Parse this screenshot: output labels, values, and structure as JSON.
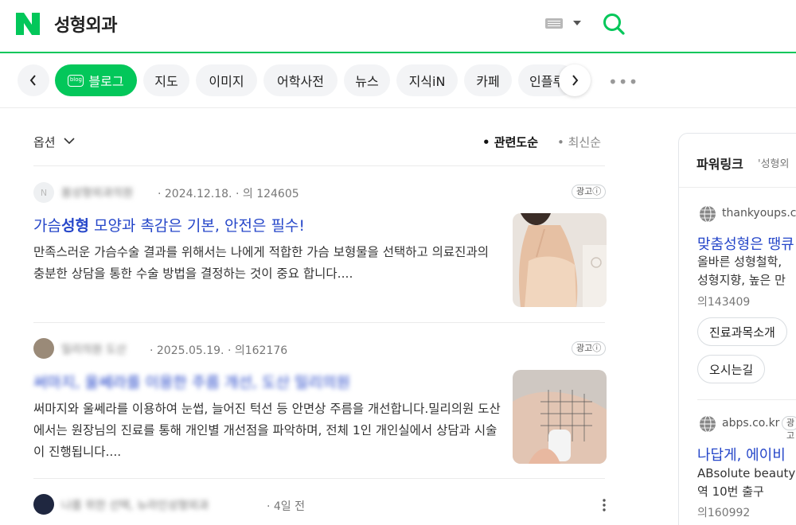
{
  "header": {
    "query": "성형외과",
    "colors": {
      "brand": "#03c75a",
      "link": "#2546c9"
    }
  },
  "tabs": {
    "items": [
      {
        "label": "블로그",
        "badge": "blog",
        "active": true
      },
      {
        "label": "지도"
      },
      {
        "label": "이미지"
      },
      {
        "label": "어학사전"
      },
      {
        "label": "뉴스"
      },
      {
        "label": "지식iN"
      },
      {
        "label": "카페"
      },
      {
        "label": "인플루"
      }
    ],
    "more": "•••"
  },
  "options": {
    "label": "옵션",
    "sort_relevance": "• 관련도순",
    "sort_recent": "• 최신순"
  },
  "results": [
    {
      "source": "봄성형외과의원",
      "meta": "· 2024.12.18. · 의 124605",
      "ad": "광고ⓘ",
      "title_pre": "가슴",
      "title_bold": "성형",
      "title_post": " 모양과 촉감은 기본, 안전은 필수!",
      "desc": "만족스러운 가슴수술 결과를 위해서는 나에게 적합한 가슴 보형물을 선택하고 의료진과의 충분한 상담을 통한 수술 방법을 결정하는 것이 중요 합니다...."
    },
    {
      "source": "밀리의원 도산",
      "meta": "· 2025.05.19. · 의162176",
      "ad": "광고ⓘ",
      "title": "써마지, 울쎄라를 이용한 주름 개선, 도산 밀리의원",
      "desc": "써마지와 울쎄라를 이용하여 눈썹, 늘어진 턱선 등 안면상 주름을 개선합니다.밀리의원 도산에서는 원장님의 진료를 통해 개인별 개선점을 파악하며, 전체 1인 개인실에서 상담과 시술이 진행됩니다...."
    },
    {
      "source": "나를 위한 선택, 뉴라인성형외과",
      "meta": "· 4일 전"
    }
  ],
  "powerlink": {
    "title": "파워링크",
    "query": "'성형외",
    "ads": [
      {
        "domain": "thankyoups.co",
        "title": "맞춤성형은 땡큐",
        "lines": [
          "올바른 성형철학,",
          "성형지향, 높은 만"
        ],
        "views": "의143409",
        "buttons": [
          "진료과목소개",
          "오시는길"
        ]
      },
      {
        "domain": "abps.co.kr",
        "ad": "광고",
        "title": "나답게, 에이비",
        "lines": [
          "ABsolute beauty!",
          "역 10번 출구"
        ],
        "views": "의160992"
      }
    ]
  }
}
